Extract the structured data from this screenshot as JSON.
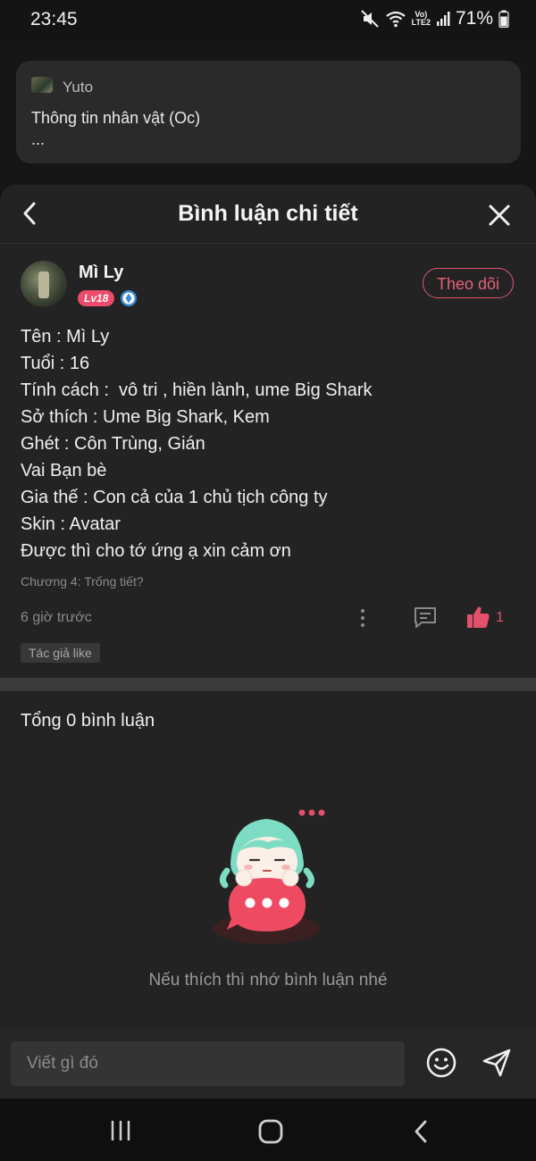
{
  "status_bar": {
    "time": "23:45",
    "battery": "71%",
    "network_label_top": "Vo)",
    "network_label_bottom": "LTE2"
  },
  "background_card": {
    "username": "Yuto",
    "text": "Thông tin nhân vật (Oc)",
    "more": "..."
  },
  "header": {
    "title": "Bình luận chi tiết"
  },
  "comment": {
    "username": "Mì Ly",
    "level": "Lv18",
    "follow_label": "Theo dõi",
    "lines": [
      "Tên : Mì Ly",
      "Tuổi : 16",
      "Tính cách :  vô tri , hiền lành, ume Big Shark",
      "Sở thích : Ume Big Shark, Kem",
      "Ghét : Côn Trùng, Gián",
      "Vai Bạn bè",
      "Gia thế : Con cả của 1 chủ tịch công ty",
      "Skin : Avatar",
      "Được thì cho tớ ứng ạ xin cảm ơn"
    ],
    "chapter": "Chương 4: Trống tiết?",
    "time": "6 giờ trước",
    "like_count": "1",
    "author_tag": "Tác giả like"
  },
  "replies": {
    "total": "Tổng 0 bình luận",
    "empty_message": "Nếu thích thì nhớ bình luận nhé"
  },
  "input": {
    "placeholder": "Viết gì đó"
  },
  "colors": {
    "accent": "#e3506d",
    "sheet_bg": "#232323",
    "input_bg": "#343434"
  },
  "icons": [
    "mute-icon",
    "wifi-icon",
    "signal-icon",
    "battery-icon",
    "back-arrow-icon",
    "close-icon",
    "verified-badge-icon",
    "more-vertical-icon",
    "comment-icon",
    "thumbs-up-icon",
    "emoji-icon",
    "send-icon",
    "nav-recent-icon",
    "nav-home-icon",
    "nav-back-icon"
  ]
}
